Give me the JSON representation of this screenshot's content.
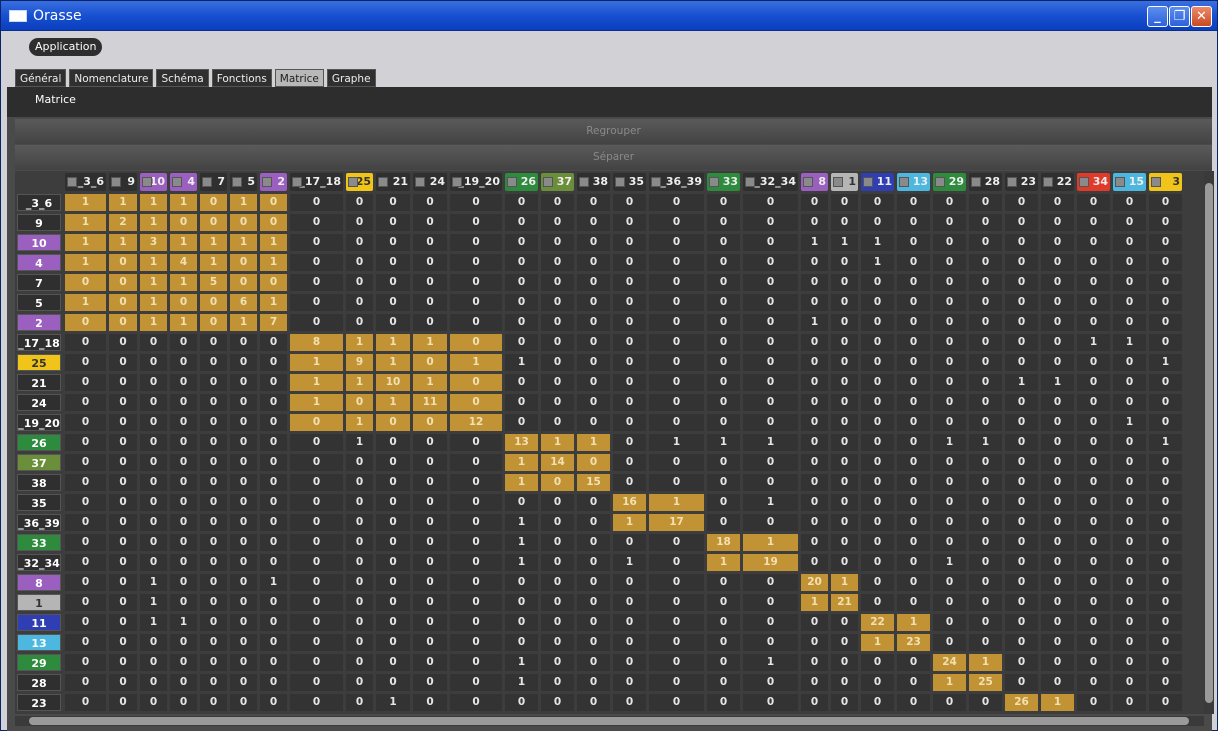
{
  "window": {
    "title": "Orasse",
    "icon": "window-app-icon",
    "controls": [
      "minimize-icon",
      "maximize-icon",
      "close-icon"
    ]
  },
  "appbar": {
    "application_label": "Application"
  },
  "tabs": [
    {
      "label": "Général",
      "active": false
    },
    {
      "label": "Nomenclature",
      "active": false
    },
    {
      "label": "Schéma",
      "active": false
    },
    {
      "label": "Fonctions",
      "active": false
    },
    {
      "label": "Matrice",
      "active": true
    },
    {
      "label": "Graphe",
      "active": false
    }
  ],
  "panel": {
    "title": "Matrice",
    "regroup_label": "Regrouper",
    "separate_label": "Séparer"
  },
  "group_colors": {
    "default": "#2f2f2f",
    "purple": "#9b5fc0",
    "yellow": "#f0c419",
    "green": "#2e8b3e",
    "olive": "#6b8e3a",
    "gray": "#b5b5b5",
    "blue": "#2f3fb3",
    "cyan": "#4cb8e0",
    "red": "#e03a2a",
    "cell_highlight": "#c29335",
    "cell_default": "#333333"
  },
  "matrix": {
    "columns": [
      {
        "label": "_3_6",
        "color": "default"
      },
      {
        "label": "9",
        "color": "default"
      },
      {
        "label": "10",
        "color": "purple"
      },
      {
        "label": "4",
        "color": "purple"
      },
      {
        "label": "7",
        "color": "default"
      },
      {
        "label": "5",
        "color": "default"
      },
      {
        "label": "2",
        "color": "purple"
      },
      {
        "label": "_17_18",
        "color": "default"
      },
      {
        "label": "25",
        "color": "yellow"
      },
      {
        "label": "21",
        "color": "default"
      },
      {
        "label": "24",
        "color": "default"
      },
      {
        "label": "_19_20",
        "color": "default"
      },
      {
        "label": "26",
        "color": "green"
      },
      {
        "label": "37",
        "color": "olive"
      },
      {
        "label": "38",
        "color": "default"
      },
      {
        "label": "35",
        "color": "default"
      },
      {
        "label": "_36_39",
        "color": "default"
      },
      {
        "label": "33",
        "color": "green"
      },
      {
        "label": "_32_34",
        "color": "default"
      },
      {
        "label": "8",
        "color": "purple"
      },
      {
        "label": "1",
        "color": "gray"
      },
      {
        "label": "11",
        "color": "blue"
      },
      {
        "label": "13",
        "color": "cyan"
      },
      {
        "label": "29",
        "color": "green"
      },
      {
        "label": "28",
        "color": "default"
      },
      {
        "label": "23",
        "color": "default"
      },
      {
        "label": "22",
        "color": "default"
      },
      {
        "label": "34",
        "color": "red"
      },
      {
        "label": "15",
        "color": "cyan"
      },
      {
        "label": "3",
        "color": "yellow"
      }
    ],
    "rows": [
      {
        "label": "_3_6",
        "color": "default",
        "values": [
          1,
          1,
          1,
          1,
          0,
          1,
          0,
          0,
          0,
          0,
          0,
          0,
          0,
          0,
          0,
          0,
          0,
          0,
          0,
          0,
          0,
          0,
          0,
          0,
          0,
          0,
          0,
          0,
          0,
          0
        ],
        "highlight": [
          0,
          1,
          2,
          3,
          4,
          5,
          6
        ]
      },
      {
        "label": "9",
        "color": "default",
        "values": [
          1,
          2,
          1,
          0,
          0,
          0,
          0,
          0,
          0,
          0,
          0,
          0,
          0,
          0,
          0,
          0,
          0,
          0,
          0,
          0,
          0,
          0,
          0,
          0,
          0,
          0,
          0,
          0,
          0,
          0
        ],
        "highlight": [
          0,
          1,
          2,
          3,
          4,
          5,
          6
        ]
      },
      {
        "label": "10",
        "color": "purple",
        "values": [
          1,
          1,
          3,
          1,
          1,
          1,
          1,
          0,
          0,
          0,
          0,
          0,
          0,
          0,
          0,
          0,
          0,
          0,
          0,
          1,
          1,
          1,
          0,
          0,
          0,
          0,
          0,
          0,
          0,
          0
        ],
        "highlight": [
          0,
          1,
          2,
          3,
          4,
          5,
          6
        ]
      },
      {
        "label": "4",
        "color": "purple",
        "values": [
          1,
          0,
          1,
          4,
          1,
          0,
          1,
          0,
          0,
          0,
          0,
          0,
          0,
          0,
          0,
          0,
          0,
          0,
          0,
          0,
          0,
          1,
          0,
          0,
          0,
          0,
          0,
          0,
          0,
          0
        ],
        "highlight": [
          0,
          1,
          2,
          3,
          4,
          5,
          6
        ]
      },
      {
        "label": "7",
        "color": "default",
        "values": [
          0,
          0,
          1,
          1,
          5,
          0,
          0,
          0,
          0,
          0,
          0,
          0,
          0,
          0,
          0,
          0,
          0,
          0,
          0,
          0,
          0,
          0,
          0,
          0,
          0,
          0,
          0,
          0,
          0,
          0
        ],
        "highlight": [
          0,
          1,
          2,
          3,
          4,
          5,
          6
        ]
      },
      {
        "label": "5",
        "color": "default",
        "values": [
          1,
          0,
          1,
          0,
          0,
          6,
          1,
          0,
          0,
          0,
          0,
          0,
          0,
          0,
          0,
          0,
          0,
          0,
          0,
          0,
          0,
          0,
          0,
          0,
          0,
          0,
          0,
          0,
          0,
          0
        ],
        "highlight": [
          0,
          1,
          2,
          3,
          4,
          5,
          6
        ]
      },
      {
        "label": "2",
        "color": "purple",
        "values": [
          0,
          0,
          1,
          1,
          0,
          1,
          7,
          0,
          0,
          0,
          0,
          0,
          0,
          0,
          0,
          0,
          0,
          0,
          0,
          1,
          0,
          0,
          0,
          0,
          0,
          0,
          0,
          0,
          0,
          0
        ],
        "highlight": [
          0,
          1,
          2,
          3,
          4,
          5,
          6
        ]
      },
      {
        "label": "_17_18",
        "color": "default",
        "values": [
          0,
          0,
          0,
          0,
          0,
          0,
          0,
          8,
          1,
          1,
          1,
          0,
          0,
          0,
          0,
          0,
          0,
          0,
          0,
          0,
          0,
          0,
          0,
          0,
          0,
          0,
          0,
          1,
          1,
          0
        ],
        "highlight": [
          7,
          8,
          9,
          10,
          11
        ]
      },
      {
        "label": "25",
        "color": "yellow",
        "values": [
          0,
          0,
          0,
          0,
          0,
          0,
          0,
          1,
          9,
          1,
          0,
          1,
          1,
          0,
          0,
          0,
          0,
          0,
          0,
          0,
          0,
          0,
          0,
          0,
          0,
          0,
          0,
          0,
          0,
          1
        ],
        "highlight": [
          7,
          8,
          9,
          10,
          11
        ]
      },
      {
        "label": "21",
        "color": "default",
        "values": [
          0,
          0,
          0,
          0,
          0,
          0,
          0,
          1,
          1,
          10,
          1,
          0,
          0,
          0,
          0,
          0,
          0,
          0,
          0,
          0,
          0,
          0,
          0,
          0,
          0,
          1,
          1,
          0,
          0,
          0
        ],
        "highlight": [
          7,
          8,
          9,
          10,
          11
        ]
      },
      {
        "label": "24",
        "color": "default",
        "values": [
          0,
          0,
          0,
          0,
          0,
          0,
          0,
          1,
          0,
          1,
          11,
          0,
          0,
          0,
          0,
          0,
          0,
          0,
          0,
          0,
          0,
          0,
          0,
          0,
          0,
          0,
          0,
          0,
          0,
          0
        ],
        "highlight": [
          7,
          8,
          9,
          10,
          11
        ]
      },
      {
        "label": "_19_20",
        "color": "default",
        "values": [
          0,
          0,
          0,
          0,
          0,
          0,
          0,
          0,
          1,
          0,
          0,
          12,
          0,
          0,
          0,
          0,
          0,
          0,
          0,
          0,
          0,
          0,
          0,
          0,
          0,
          0,
          0,
          0,
          1,
          0
        ],
        "highlight": [
          7,
          8,
          9,
          10,
          11
        ]
      },
      {
        "label": "26",
        "color": "green",
        "values": [
          0,
          0,
          0,
          0,
          0,
          0,
          0,
          0,
          1,
          0,
          0,
          0,
          13,
          1,
          1,
          0,
          1,
          1,
          1,
          0,
          0,
          0,
          0,
          1,
          1,
          0,
          0,
          0,
          0,
          1
        ],
        "highlight": [
          12,
          13,
          14
        ]
      },
      {
        "label": "37",
        "color": "olive",
        "values": [
          0,
          0,
          0,
          0,
          0,
          0,
          0,
          0,
          0,
          0,
          0,
          0,
          1,
          14,
          0,
          0,
          0,
          0,
          0,
          0,
          0,
          0,
          0,
          0,
          0,
          0,
          0,
          0,
          0,
          0
        ],
        "highlight": [
          12,
          13,
          14
        ]
      },
      {
        "label": "38",
        "color": "default",
        "values": [
          0,
          0,
          0,
          0,
          0,
          0,
          0,
          0,
          0,
          0,
          0,
          0,
          1,
          0,
          15,
          0,
          0,
          0,
          0,
          0,
          0,
          0,
          0,
          0,
          0,
          0,
          0,
          0,
          0,
          0
        ],
        "highlight": [
          12,
          13,
          14
        ]
      },
      {
        "label": "35",
        "color": "default",
        "values": [
          0,
          0,
          0,
          0,
          0,
          0,
          0,
          0,
          0,
          0,
          0,
          0,
          0,
          0,
          0,
          16,
          1,
          0,
          1,
          0,
          0,
          0,
          0,
          0,
          0,
          0,
          0,
          0,
          0,
          0
        ],
        "highlight": [
          15,
          16
        ]
      },
      {
        "label": "_36_39",
        "color": "default",
        "values": [
          0,
          0,
          0,
          0,
          0,
          0,
          0,
          0,
          0,
          0,
          0,
          0,
          1,
          0,
          0,
          1,
          17,
          0,
          0,
          0,
          0,
          0,
          0,
          0,
          0,
          0,
          0,
          0,
          0,
          0
        ],
        "highlight": [
          15,
          16
        ]
      },
      {
        "label": "33",
        "color": "green",
        "values": [
          0,
          0,
          0,
          0,
          0,
          0,
          0,
          0,
          0,
          0,
          0,
          0,
          1,
          0,
          0,
          0,
          0,
          18,
          1,
          0,
          0,
          0,
          0,
          0,
          0,
          0,
          0,
          0,
          0,
          0
        ],
        "highlight": [
          17,
          18
        ]
      },
      {
        "label": "_32_34",
        "color": "default",
        "values": [
          0,
          0,
          0,
          0,
          0,
          0,
          0,
          0,
          0,
          0,
          0,
          0,
          1,
          0,
          0,
          1,
          0,
          1,
          19,
          0,
          0,
          0,
          0,
          1,
          0,
          0,
          0,
          0,
          0,
          0
        ],
        "highlight": [
          17,
          18
        ]
      },
      {
        "label": "8",
        "color": "purple",
        "values": [
          0,
          0,
          1,
          0,
          0,
          0,
          1,
          0,
          0,
          0,
          0,
          0,
          0,
          0,
          0,
          0,
          0,
          0,
          0,
          20,
          1,
          0,
          0,
          0,
          0,
          0,
          0,
          0,
          0,
          0
        ],
        "highlight": [
          19,
          20
        ]
      },
      {
        "label": "1",
        "color": "gray",
        "values": [
          0,
          0,
          1,
          0,
          0,
          0,
          0,
          0,
          0,
          0,
          0,
          0,
          0,
          0,
          0,
          0,
          0,
          0,
          0,
          1,
          21,
          0,
          0,
          0,
          0,
          0,
          0,
          0,
          0,
          0
        ],
        "highlight": [
          19,
          20
        ]
      },
      {
        "label": "11",
        "color": "blue",
        "values": [
          0,
          0,
          1,
          1,
          0,
          0,
          0,
          0,
          0,
          0,
          0,
          0,
          0,
          0,
          0,
          0,
          0,
          0,
          0,
          0,
          0,
          22,
          1,
          0,
          0,
          0,
          0,
          0,
          0,
          0
        ],
        "highlight": [
          21,
          22
        ]
      },
      {
        "label": "13",
        "color": "cyan",
        "values": [
          0,
          0,
          0,
          0,
          0,
          0,
          0,
          0,
          0,
          0,
          0,
          0,
          0,
          0,
          0,
          0,
          0,
          0,
          0,
          0,
          0,
          1,
          23,
          0,
          0,
          0,
          0,
          0,
          0,
          0
        ],
        "highlight": [
          21,
          22
        ]
      },
      {
        "label": "29",
        "color": "green",
        "values": [
          0,
          0,
          0,
          0,
          0,
          0,
          0,
          0,
          0,
          0,
          0,
          0,
          1,
          0,
          0,
          0,
          0,
          0,
          1,
          0,
          0,
          0,
          0,
          24,
          1,
          0,
          0,
          0,
          0,
          0
        ],
        "highlight": [
          23,
          24
        ]
      },
      {
        "label": "28",
        "color": "default",
        "values": [
          0,
          0,
          0,
          0,
          0,
          0,
          0,
          0,
          0,
          0,
          0,
          0,
          1,
          0,
          0,
          0,
          0,
          0,
          0,
          0,
          0,
          0,
          0,
          1,
          25,
          0,
          0,
          0,
          0,
          0
        ],
        "highlight": [
          23,
          24
        ]
      },
      {
        "label": "23",
        "color": "default",
        "values": [
          0,
          0,
          0,
          0,
          0,
          0,
          0,
          0,
          0,
          1,
          0,
          0,
          0,
          0,
          0,
          0,
          0,
          0,
          0,
          0,
          0,
          0,
          0,
          0,
          0,
          26,
          1,
          0,
          0,
          0
        ],
        "highlight": [
          25,
          26
        ]
      }
    ]
  }
}
